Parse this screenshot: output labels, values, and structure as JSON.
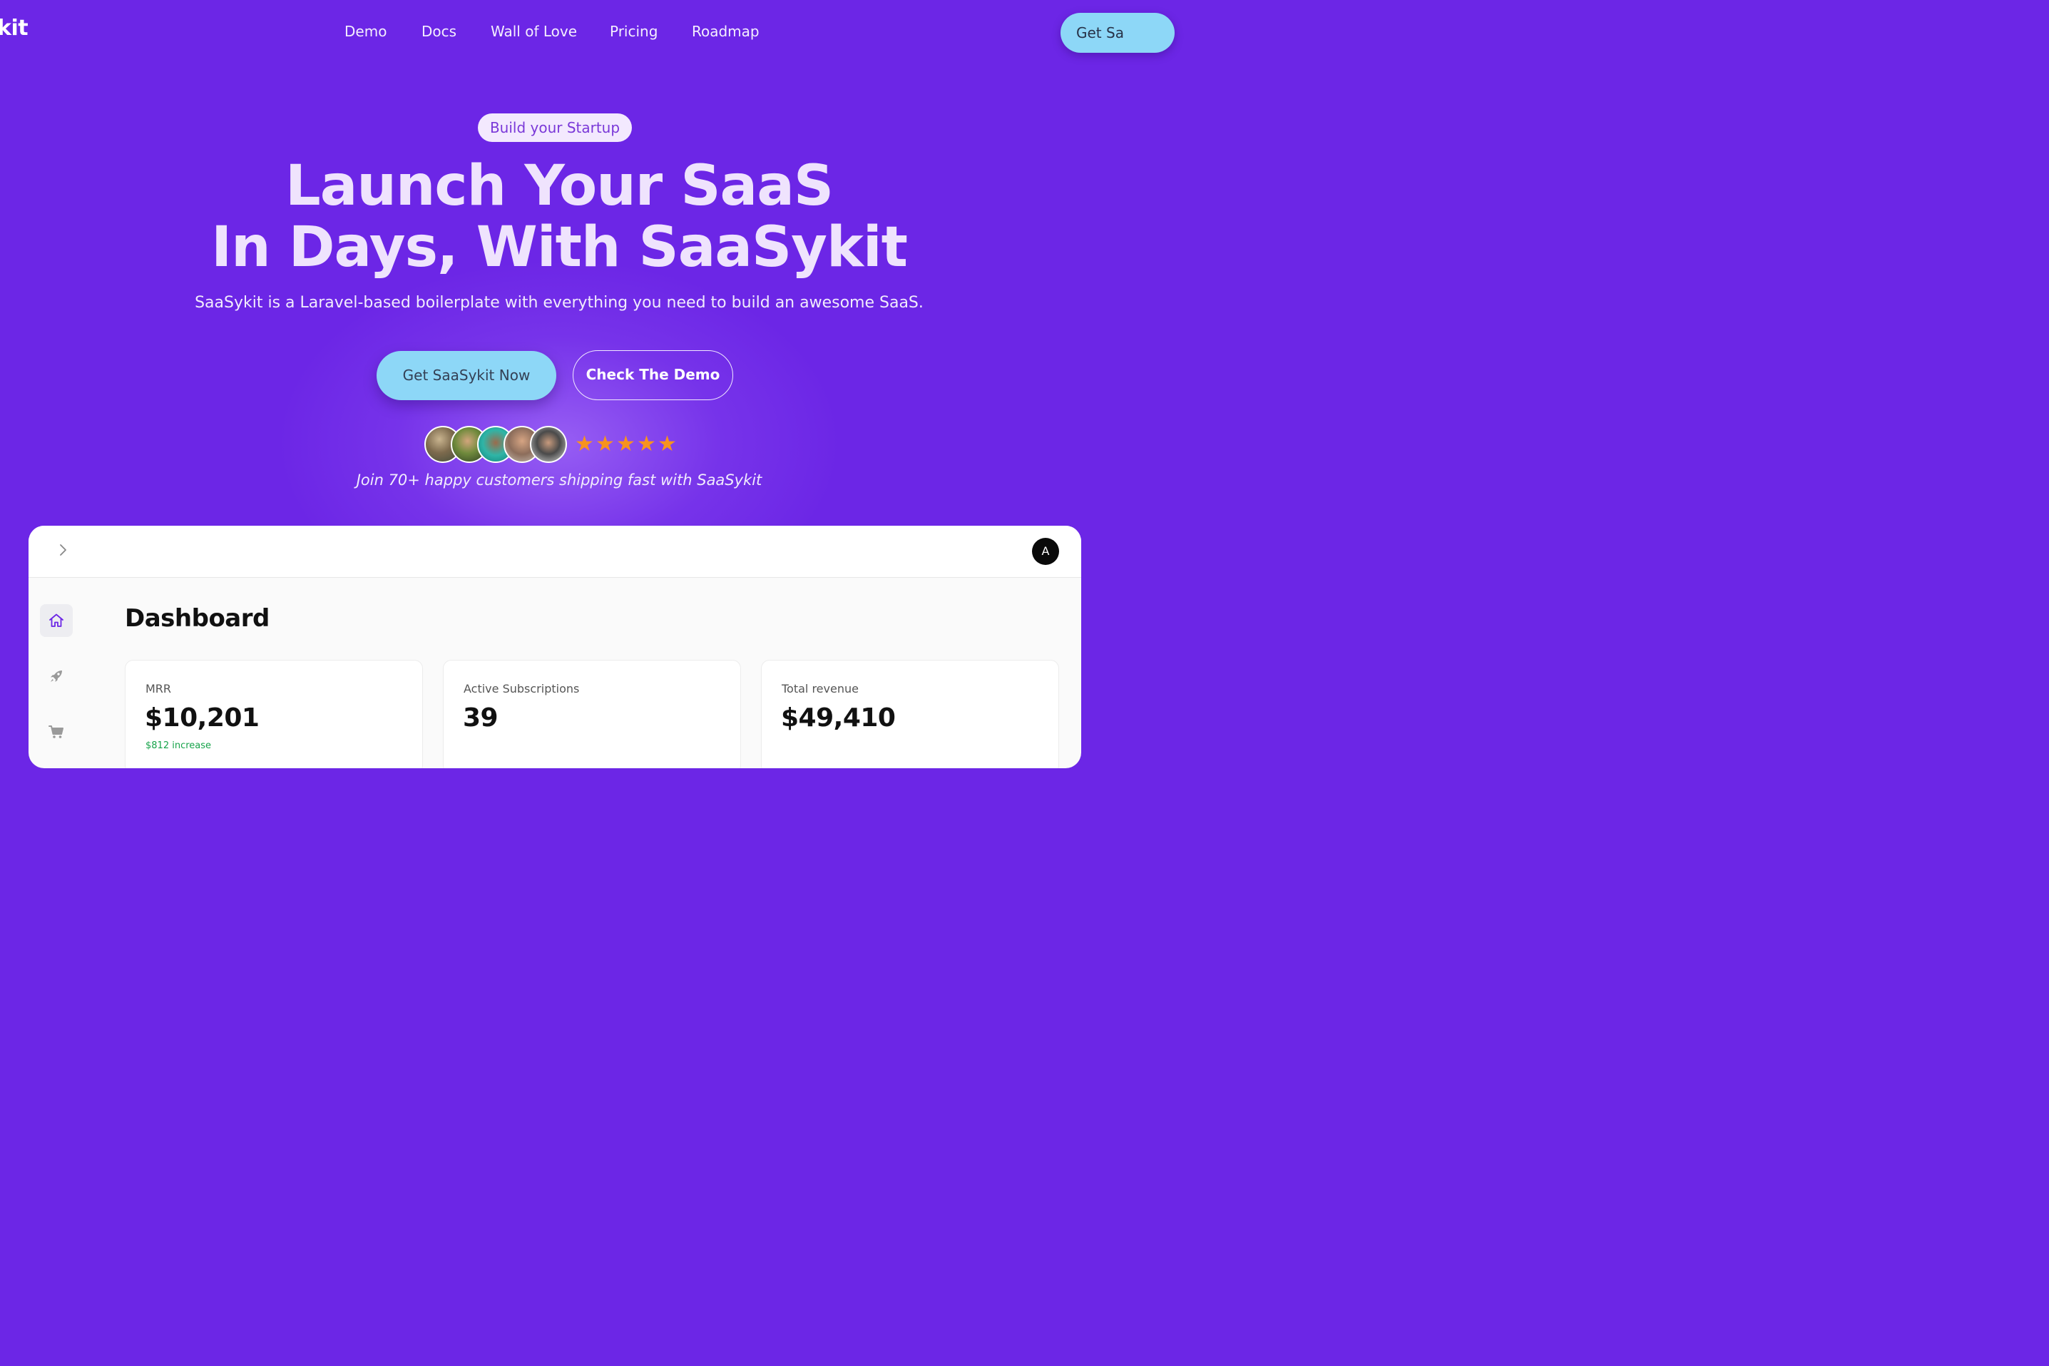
{
  "brand": {
    "logo_text": "kit"
  },
  "nav": {
    "items": [
      {
        "label": "Demo"
      },
      {
        "label": "Docs"
      },
      {
        "label": "Wall of Love"
      },
      {
        "label": "Pricing"
      },
      {
        "label": "Roadmap"
      }
    ],
    "cta_label": "Get Sa"
  },
  "hero": {
    "badge": "Build your Startup",
    "headline_line1": "Launch Your SaaS",
    "headline_line2": "In Days, With SaaSykit",
    "subtitle": "SaaSykit is a Laravel-based boilerplate with everything you need to build an awesome SaaS.",
    "primary_button": "Get SaaSykit Now",
    "secondary_button": "Check The Demo",
    "rating_stars": 5,
    "social_proof": "Join 70+ happy customers shipping fast with SaaSykit"
  },
  "colors": {
    "background": "#6c26e6",
    "cta": "#8dd7f7",
    "star": "#f7931e",
    "trend_up": "#16a34a"
  },
  "dashboard": {
    "user_initial": "A",
    "title": "Dashboard",
    "sidebar_icons": [
      "home-icon",
      "rocket-icon",
      "cart-icon"
    ],
    "cards": [
      {
        "label": "MRR",
        "value": "$10,201",
        "trend": "$812 increase"
      },
      {
        "label": "Active Subscriptions",
        "value": "39"
      },
      {
        "label": "Total revenue",
        "value": "$49,410"
      }
    ]
  }
}
